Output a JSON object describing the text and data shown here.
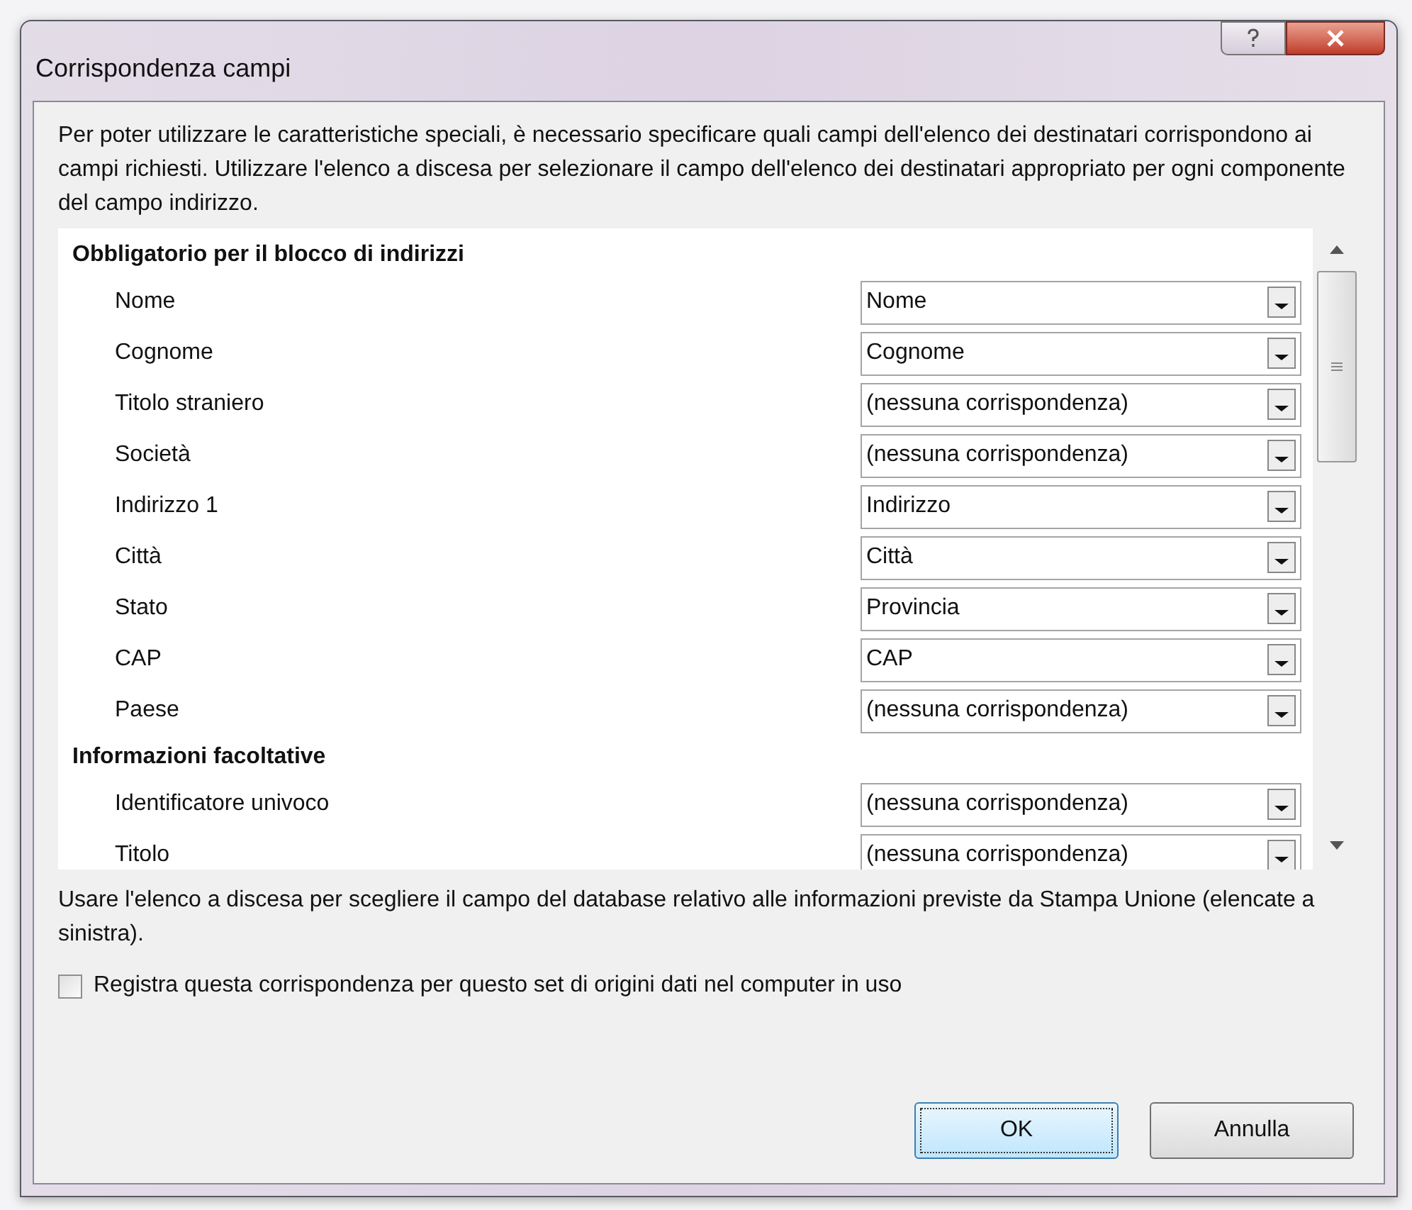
{
  "window": {
    "title": "Corrispondenza campi"
  },
  "intro": "Per poter utilizzare le caratteristiche speciali, è necessario specificare quali campi dell'elenco dei destinatari corrispondono ai campi richiesti. Utilizzare l'elenco a discesa per selezionare il campo dell'elenco dei destinatari appropriato per ogni componente del campo indirizzo.",
  "sections": [
    {
      "heading": "Obbligatorio per il blocco di indirizzi",
      "fields": [
        {
          "label": "Nome",
          "value": "Nome"
        },
        {
          "label": "Cognome",
          "value": "Cognome"
        },
        {
          "label": "Titolo straniero",
          "value": "(nessuna corrispondenza)"
        },
        {
          "label": "Società",
          "value": "(nessuna corrispondenza)"
        },
        {
          "label": "Indirizzo 1",
          "value": "Indirizzo"
        },
        {
          "label": "Città",
          "value": "Città"
        },
        {
          "label": "Stato",
          "value": "Provincia"
        },
        {
          "label": "CAP",
          "value": "CAP"
        },
        {
          "label": "Paese",
          "value": "(nessuna corrispondenza)"
        }
      ]
    },
    {
      "heading": "Informazioni facoltative",
      "fields": [
        {
          "label": "Identificatore univoco",
          "value": "(nessuna corrispondenza)"
        },
        {
          "label": "Titolo",
          "value": "(nessuna corrispondenza)"
        }
      ]
    }
  ],
  "hint": "Usare l'elenco a discesa per scegliere il campo del database relativo alle informazioni previste da Stampa Unione (elencate a sinistra).",
  "remember": {
    "label": "Registra questa corrispondenza per questo set di origini dati nel computer in uso",
    "checked": false
  },
  "buttons": [
    {
      "label": "OK",
      "default": true
    },
    {
      "label": "Annulla",
      "default": false
    }
  ]
}
